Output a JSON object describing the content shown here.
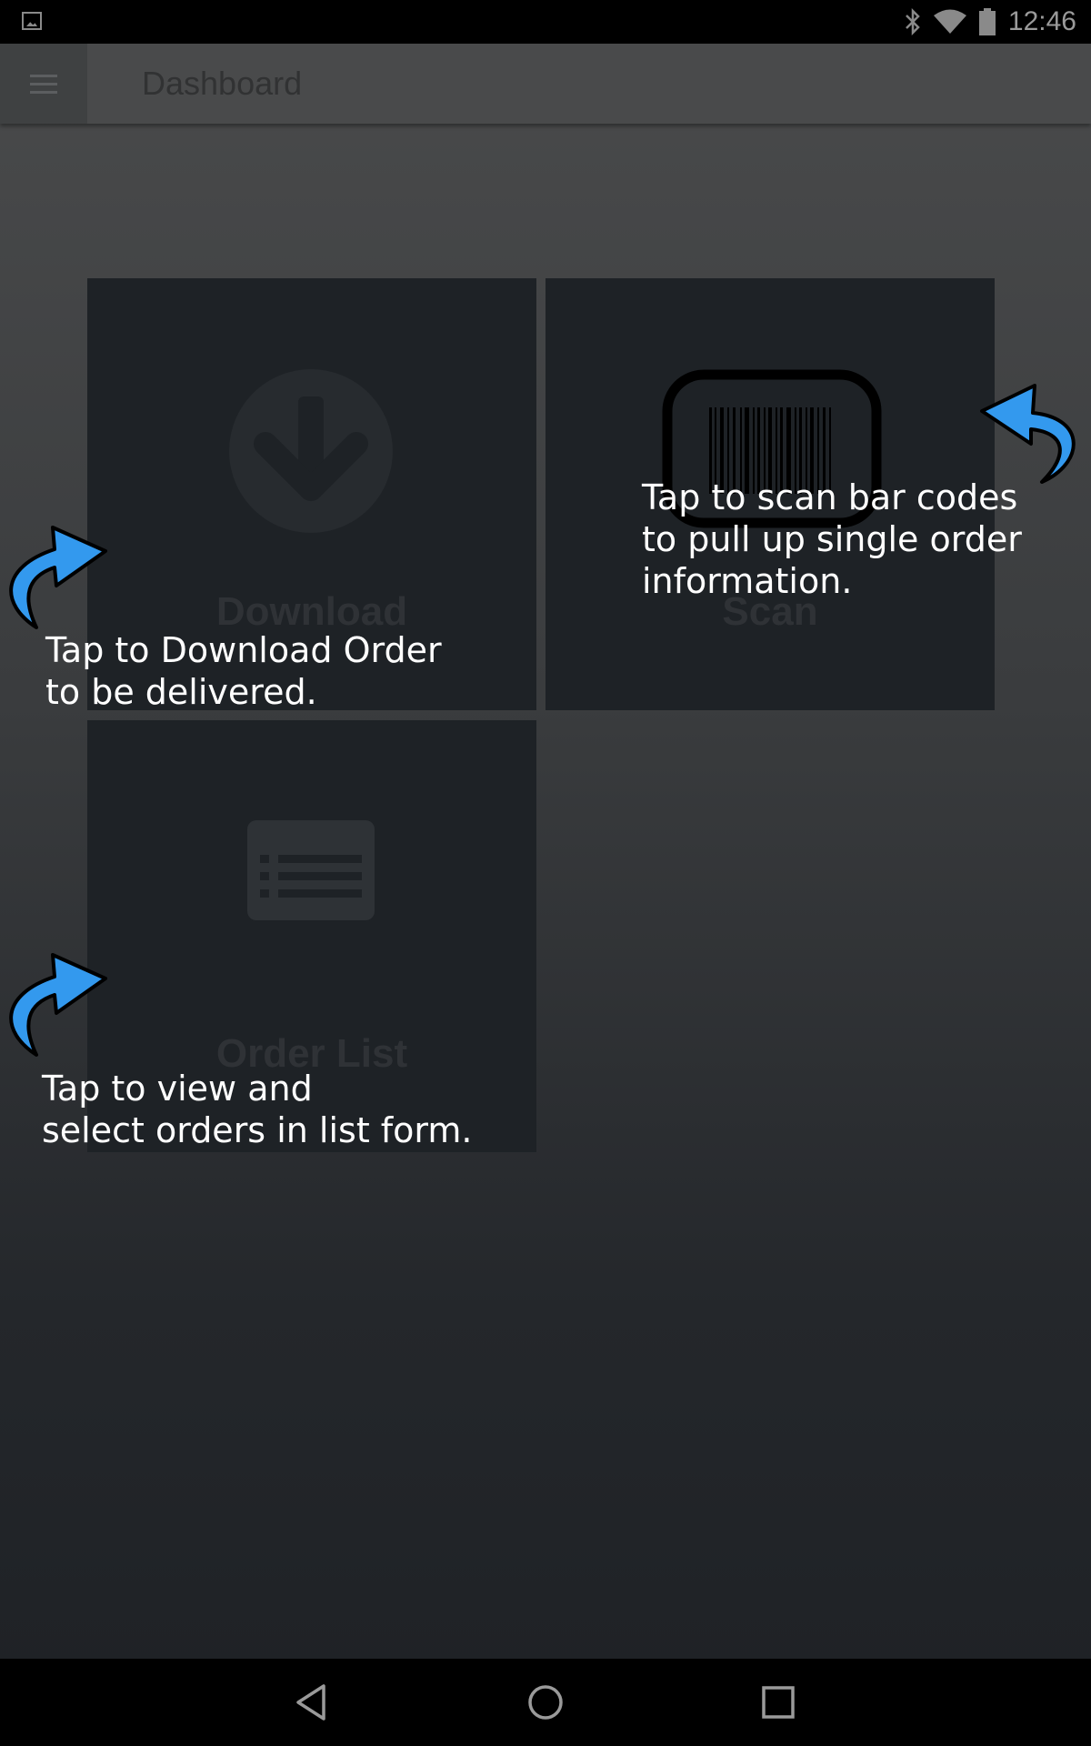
{
  "status_bar": {
    "time": "12:46",
    "icons": [
      "gallery-icon",
      "bluetooth-icon",
      "wifi-icon",
      "battery-icon"
    ]
  },
  "app_bar": {
    "title": "Dashboard",
    "menu_icon": "hamburger-menu-icon"
  },
  "tiles": [
    {
      "id": "download",
      "label": "Download",
      "icon": "download-arrow-icon"
    },
    {
      "id": "scan",
      "label": "Scan",
      "icon": "barcode-icon"
    },
    {
      "id": "order_list",
      "label": "Order List",
      "icon": "list-icon"
    }
  ],
  "hints": {
    "download": [
      "Tap to Download Order",
      "to be delivered."
    ],
    "scan": [
      "Tap to scan bar codes",
      "to pull up single order",
      "information."
    ],
    "order_list": [
      "Tap to view and",
      "select orders in list form."
    ]
  },
  "nav_bar": {
    "icons": [
      "back-icon",
      "home-icon",
      "recents-icon"
    ]
  },
  "colors": {
    "hint_arrow": "#3399ee",
    "tile_bg": "#1e2226",
    "app_bar": "#494a4b"
  }
}
